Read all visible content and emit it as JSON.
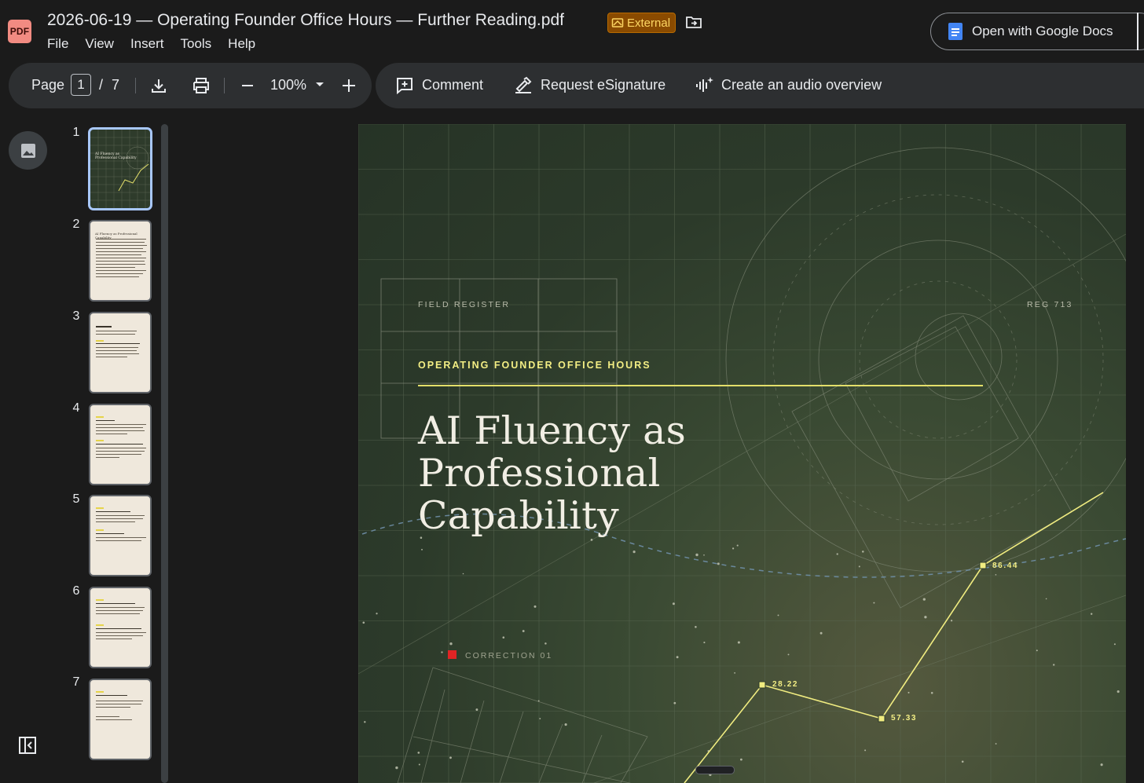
{
  "app": {
    "badge": "PDF",
    "title": "2026-06-19 — Operating Founder Office Hours — Further Reading.pdf",
    "external_label": "External",
    "menu": [
      "File",
      "View",
      "Insert",
      "Tools",
      "Help"
    ],
    "open_with": "Open with Google Docs"
  },
  "toolbar": {
    "page_label": "Page",
    "current_page": "1",
    "page_sep": "/",
    "total_pages": "7",
    "zoom": "100%",
    "comment": "Comment",
    "esign": "Request eSignature",
    "audio": "Create an audio overview"
  },
  "thumbnails": [
    "1",
    "2",
    "3",
    "4",
    "5",
    "6",
    "7"
  ],
  "cover": {
    "kicker_left": "FIELD REGISTER",
    "kicker_right": "REG 713",
    "event": "OPERATING FOUNDER OFFICE HOURS",
    "title_line1": "AI Fluency as Professional",
    "title_line2": "Capability",
    "correction": "CORRECTION 01",
    "points": [
      "28.22",
      "57.33",
      "86.44"
    ],
    "thumb_title": "AI Fluency as Professional Capability"
  },
  "colors": {
    "accent_yellow": "#f3ee84",
    "correction_red": "#e02424",
    "external_badge": "#8a4b00",
    "page_green": "#2c3a2a"
  }
}
